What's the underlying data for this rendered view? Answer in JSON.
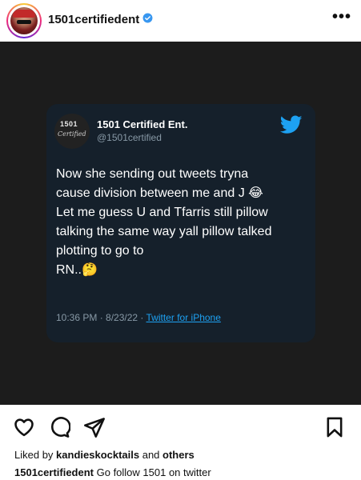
{
  "header": {
    "username": "1501certifiedent",
    "more_label": "•••"
  },
  "tweet": {
    "avatar_text_1": "1501",
    "avatar_text_2": "Certified",
    "display_name": "1501 Certified Ent.",
    "handle": "@1501certified",
    "text": "Now she sending out tweets tryna\ncause division between me and J 😂\nLet me guess U and Tfarris still pillow\ntalking the same way yall pillow talked\nplotting to go to\nRN..🤔",
    "time": "10:36 PM · 8/23/22 · ",
    "source": "Twitter for iPhone",
    "colors": {
      "card_bg": "#15202b",
      "accent": "#1da1f2"
    }
  },
  "post": {
    "liked_prefix": "Liked by ",
    "liked_user": "kandieskocktails",
    "liked_and": " and ",
    "liked_others": "others",
    "caption_user": "1501certifiedent",
    "caption_text": " Go follow 1501 on twitter"
  }
}
